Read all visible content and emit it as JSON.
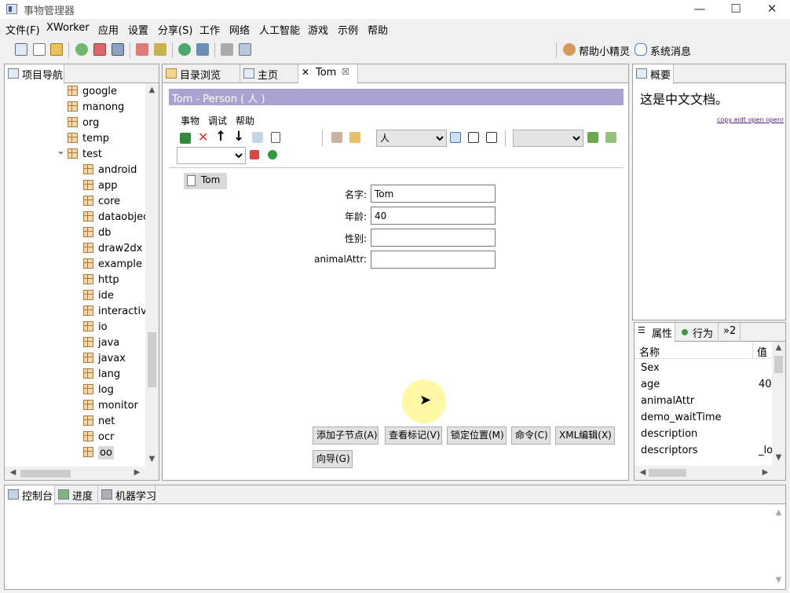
{
  "window": {
    "title": "事物管理器"
  },
  "menu": [
    "文件(F)",
    "XWorker",
    "应用",
    "设置",
    "分享(S)",
    "工作",
    "网络",
    "人工智能",
    "游戏",
    "示例",
    "帮助"
  ],
  "toolbar": {
    "help_wizard": "帮助小精灵",
    "system_messages": "系统消息"
  },
  "navigator": {
    "tab": "项目导航",
    "items": [
      {
        "label": "google",
        "level": 1
      },
      {
        "label": "manong",
        "level": 1
      },
      {
        "label": "org",
        "level": 1
      },
      {
        "label": "temp",
        "level": 1
      },
      {
        "label": "test",
        "level": 1,
        "expanded": true
      },
      {
        "label": "android",
        "level": 2
      },
      {
        "label": "app",
        "level": 2
      },
      {
        "label": "core",
        "level": 2
      },
      {
        "label": "dataobjec",
        "level": 2
      },
      {
        "label": "db",
        "level": 2
      },
      {
        "label": "draw2dx",
        "level": 2
      },
      {
        "label": "example",
        "level": 2
      },
      {
        "label": "http",
        "level": 2
      },
      {
        "label": "ide",
        "level": 2
      },
      {
        "label": "interactive",
        "level": 2
      },
      {
        "label": "io",
        "level": 2
      },
      {
        "label": "java",
        "level": 2
      },
      {
        "label": "javax",
        "level": 2
      },
      {
        "label": "lang",
        "level": 2
      },
      {
        "label": "log",
        "level": 2
      },
      {
        "label": "monitor",
        "level": 2
      },
      {
        "label": "net",
        "level": 2
      },
      {
        "label": "ocr",
        "level": 2
      },
      {
        "label": "oo",
        "level": 2,
        "selected": true
      }
    ]
  },
  "editor": {
    "tabs": [
      "目录浏览",
      "主页",
      "Tom"
    ],
    "header": "Tom - Person ( 人 )",
    "submenu": [
      "事物",
      "调试",
      "帮助"
    ],
    "type_combo": "人",
    "node_label": "Tom",
    "fields": [
      {
        "label": "名字:",
        "value": "Tom"
      },
      {
        "label": "年龄:",
        "value": "40"
      },
      {
        "label": "性别:",
        "value": ""
      },
      {
        "label": "animalAttr:",
        "value": ""
      }
    ],
    "buttons": [
      "添加子节点(A)",
      "查看标记(V)",
      "锁定位置(M)",
      "命令(C)",
      "XML编辑(X)",
      "向导(G)"
    ]
  },
  "summary": {
    "tab": "概要",
    "text": "这是中文文档。",
    "links": [
      "copy",
      "eidt",
      "open",
      "openr"
    ]
  },
  "properties": {
    "tabs": [
      "属性",
      "行为",
      "»2"
    ],
    "headers": [
      "名称",
      "值"
    ],
    "rows": [
      {
        "name": "Sex",
        "value": ""
      },
      {
        "name": "age",
        "value": "40"
      },
      {
        "name": "animalAttr",
        "value": ""
      },
      {
        "name": "demo_waitTime",
        "value": ""
      },
      {
        "name": "description",
        "value": ""
      },
      {
        "name": "descriptors",
        "value": "_lo"
      }
    ]
  },
  "bottom": {
    "tabs": [
      "控制台",
      "进度",
      "机器学习"
    ]
  },
  "colors": {
    "header_bar": "#a9a3d1",
    "highlight": "#fff79a"
  }
}
